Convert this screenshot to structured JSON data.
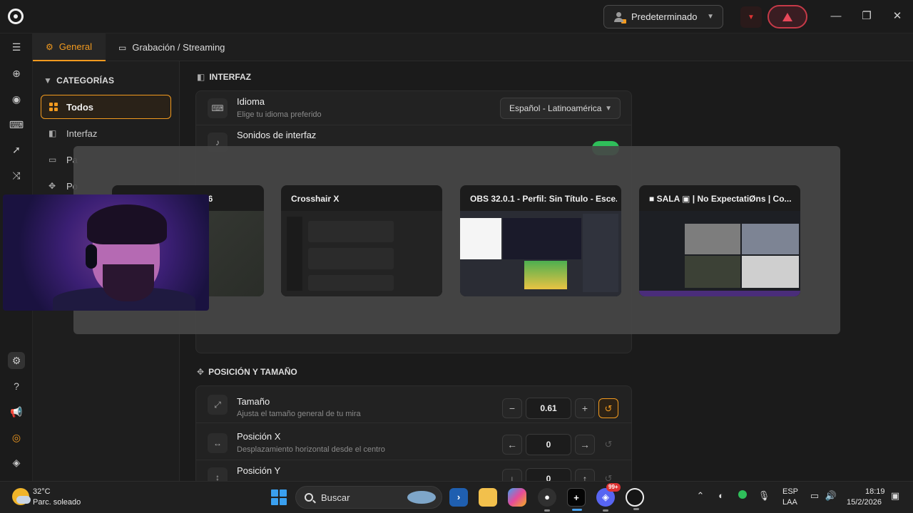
{
  "titlebar": {
    "profile": "Predeterminado",
    "window_controls": [
      "minimize-icon",
      "restore-icon",
      "close-icon"
    ]
  },
  "tabs": [
    {
      "label": "General",
      "icon": "gear-icon",
      "active": true
    },
    {
      "label": "Grabación / Streaming",
      "icon": "video-camera-icon",
      "active": false
    }
  ],
  "categories": {
    "title": "CATEGORÍAS",
    "items": [
      {
        "label": "Todos",
        "active": true
      },
      {
        "label": "Interfaz"
      },
      {
        "label": "Pa"
      },
      {
        "label": "Po"
      }
    ]
  },
  "interface_section": {
    "title": "INTERFAZ",
    "language": {
      "title": "Idioma",
      "subtitle": "Elige tu idioma preferido",
      "value": "Español - Latinoamérica"
    },
    "sounds": {
      "title": "Sonidos de interfaz",
      "enabled": true
    }
  },
  "position_section": {
    "title": "POSICIÓN Y TAMAÑO",
    "rows": [
      {
        "title": "Tamaño",
        "subtitle": "Ajusta el tamaño general de tu mira",
        "value": "0.61",
        "dec": "−",
        "inc": "+"
      },
      {
        "title": "Posición X",
        "subtitle": "Desplazamiento horizontal desde el centro",
        "value": "0",
        "dec": "←",
        "inc": "→"
      },
      {
        "title": "Posición Y",
        "subtitle": "",
        "value": "0",
        "dec": "↓",
        "inc": "↑"
      }
    ]
  },
  "task_switcher": {
    "windows": [
      {
        "title": "96"
      },
      {
        "title": "Crosshair X"
      },
      {
        "title": "OBS 32.0.1 - Perfil: Sin Título - Esce..."
      },
      {
        "title": "■ SALA ▣ | No ExpectatiØns | Co..."
      }
    ]
  },
  "taskbar": {
    "temperature": "32°C",
    "weather": "Parc. soleado",
    "search_placeholder": "Buscar",
    "language": "ESP",
    "layout": "LAA",
    "time": "18:19",
    "date": "15/2/2026",
    "badge": "99+"
  },
  "colors": {
    "accent": "#f29a1f",
    "toggle_on": "#2fbf5a",
    "alert": "#e8485a"
  }
}
